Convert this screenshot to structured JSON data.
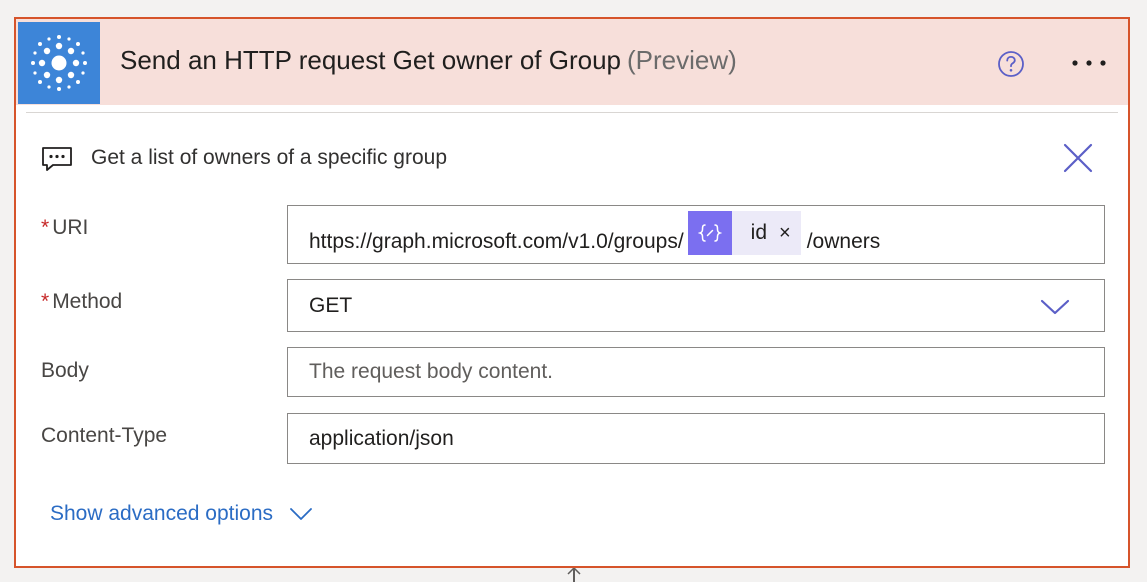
{
  "action": {
    "title": "Send an HTTP request Get owner of Group",
    "preview": "(Preview)",
    "description": "Get a list of owners of a specific group"
  },
  "icons": {
    "connector": "http-connector-icon",
    "help": "question-circle-icon",
    "more": "ellipsis-icon",
    "description": "comment-icon",
    "close": "close-icon",
    "token": "dynamic-expression-icon",
    "method_dropdown": "chevron-down-icon",
    "advanced": "chevron-down-icon"
  },
  "fields": {
    "uri": {
      "required_mark": "*",
      "label": "URI",
      "prefix": "https://graph.microsoft.com/v1.0/groups/",
      "token": {
        "label": "id",
        "remove": "×"
      },
      "suffix": "/owners"
    },
    "method": {
      "required_mark": "*",
      "label": "Method",
      "value": "GET"
    },
    "body": {
      "label": "Body",
      "placeholder": "The request body content."
    },
    "content_type": {
      "label": "Content-Type",
      "value": "application/json"
    }
  },
  "advanced": {
    "label": "Show advanced options"
  },
  "colors": {
    "border": "#d6542b",
    "header_background": "#f7dfda",
    "connector_background": "#3d85d8",
    "token_background": "#7b6ff0",
    "accent": "#5b5fc7",
    "link": "#2b6cc4"
  }
}
